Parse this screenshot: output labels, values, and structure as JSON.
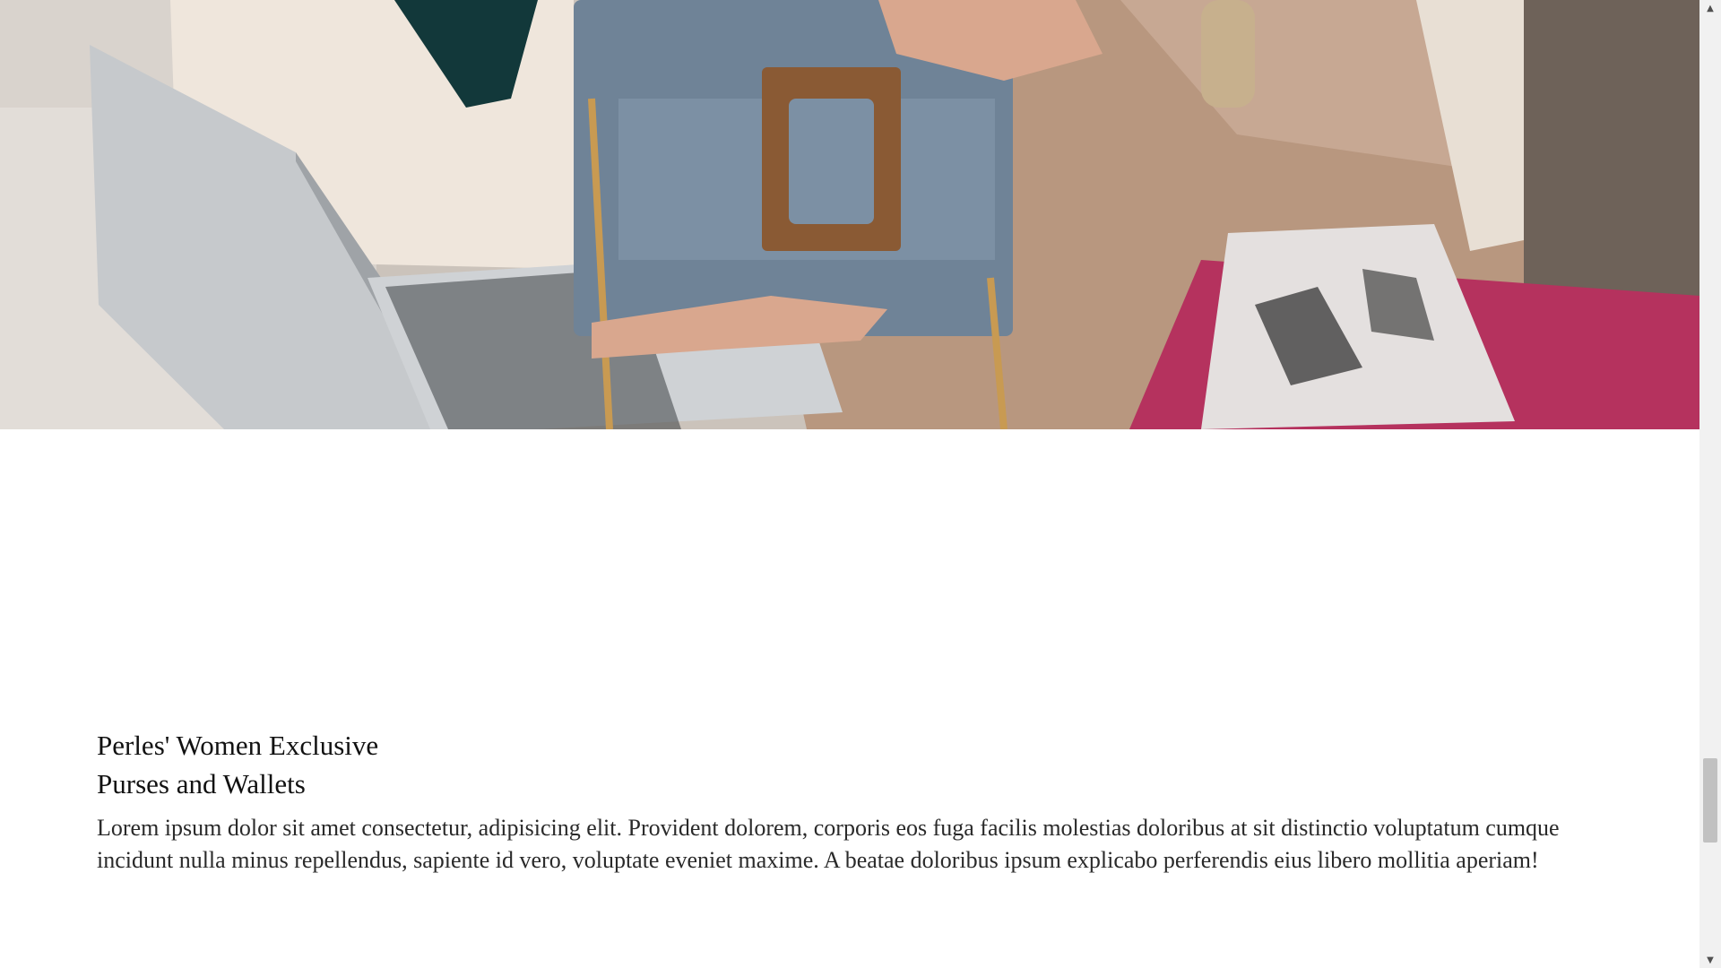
{
  "hero": {
    "image_description_icon": "hero-photo-icon"
  },
  "section": {
    "heading_line1": "Perles' Women Exclusive",
    "heading_line2": "Purses and Wallets",
    "paragraph": "Lorem ipsum dolor sit amet consectetur, adipisicing elit. Provident dolorem, corporis eos fuga facilis molestias doloribus at sit distinctio voluptatum cumque incidunt nulla minus repellendus, sapiente id vero, voluptate eveniet maxime. A beatae doloribus ipsum explicabo perferendis eius libero mollitia aperiam!"
  },
  "scrollbar": {
    "up_icon": "▲",
    "down_icon": "▼"
  },
  "colors": {
    "background": "#ffffff",
    "heading": "#111111",
    "body_text": "#2a2a2a",
    "scroll_track": "#f1f1f1",
    "scroll_thumb": "#c1c1c1"
  }
}
